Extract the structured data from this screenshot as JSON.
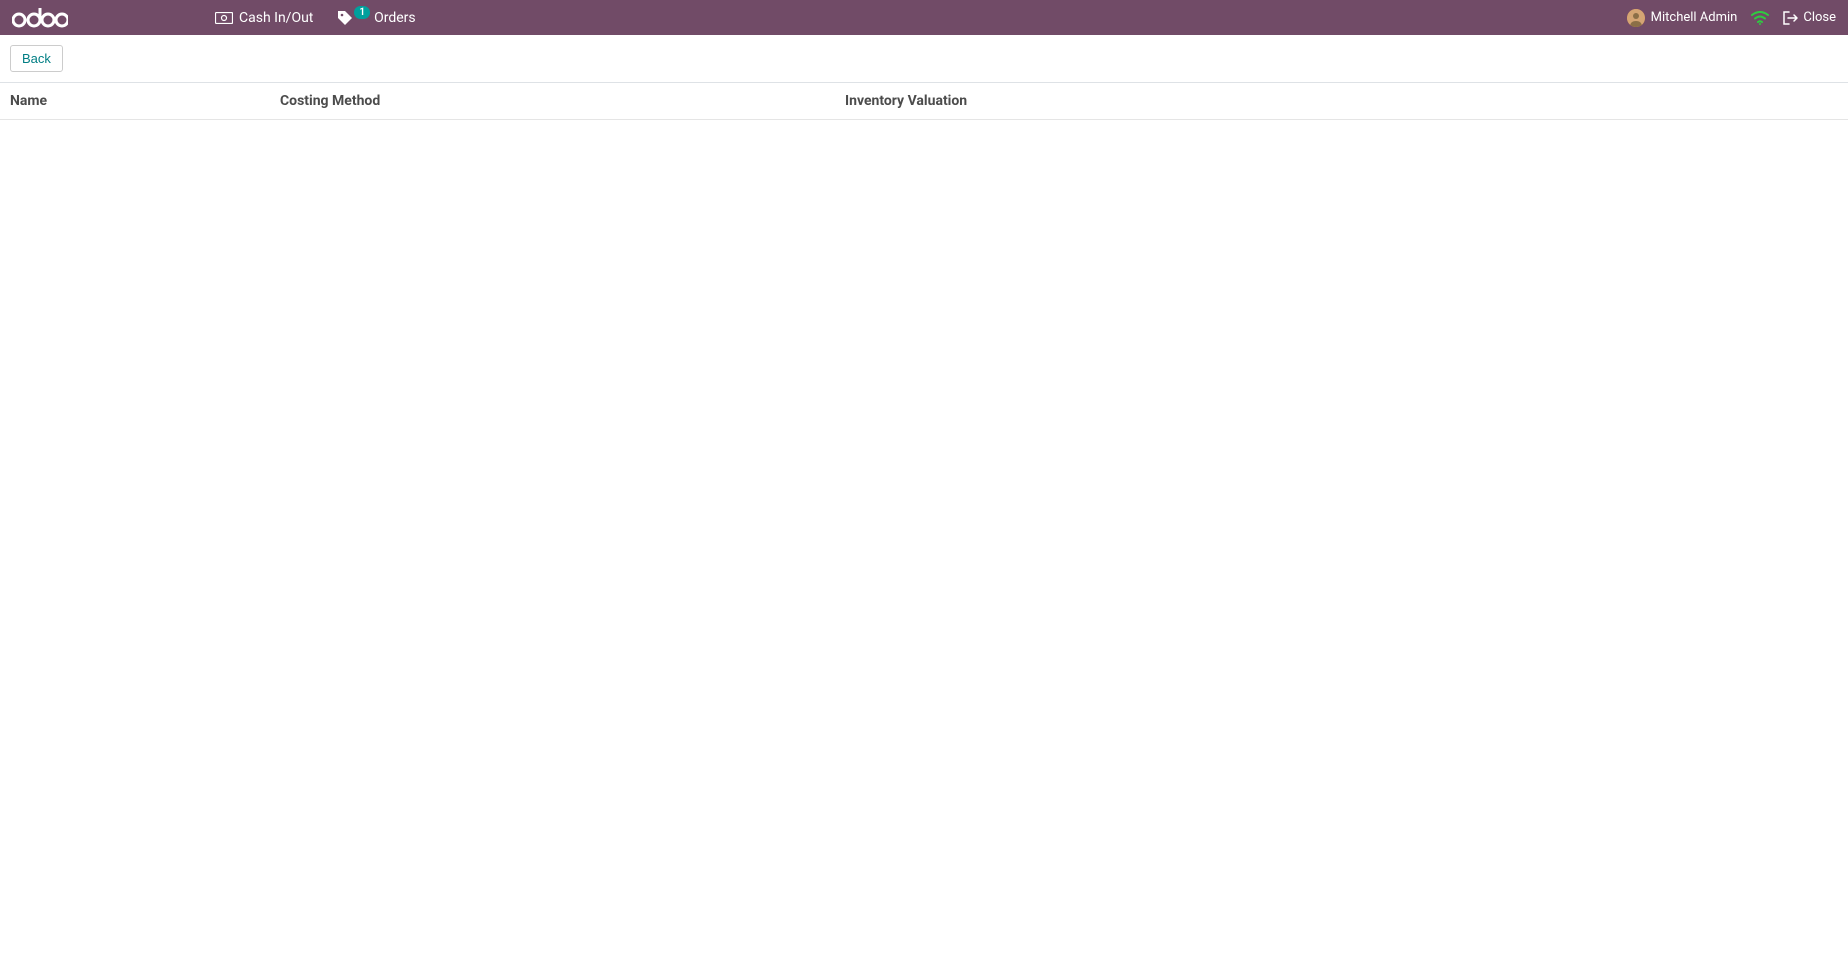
{
  "navbar": {
    "cash_label": "Cash In/Out",
    "orders_label": "Orders",
    "orders_badge": "1",
    "user_name": "Mitchell Admin",
    "close_label": "Close"
  },
  "subheader": {
    "back_label": "Back"
  },
  "table": {
    "headers": {
      "name": "Name",
      "costing": "Costing Method",
      "inventory": "Inventory Valuation"
    },
    "rows": []
  }
}
